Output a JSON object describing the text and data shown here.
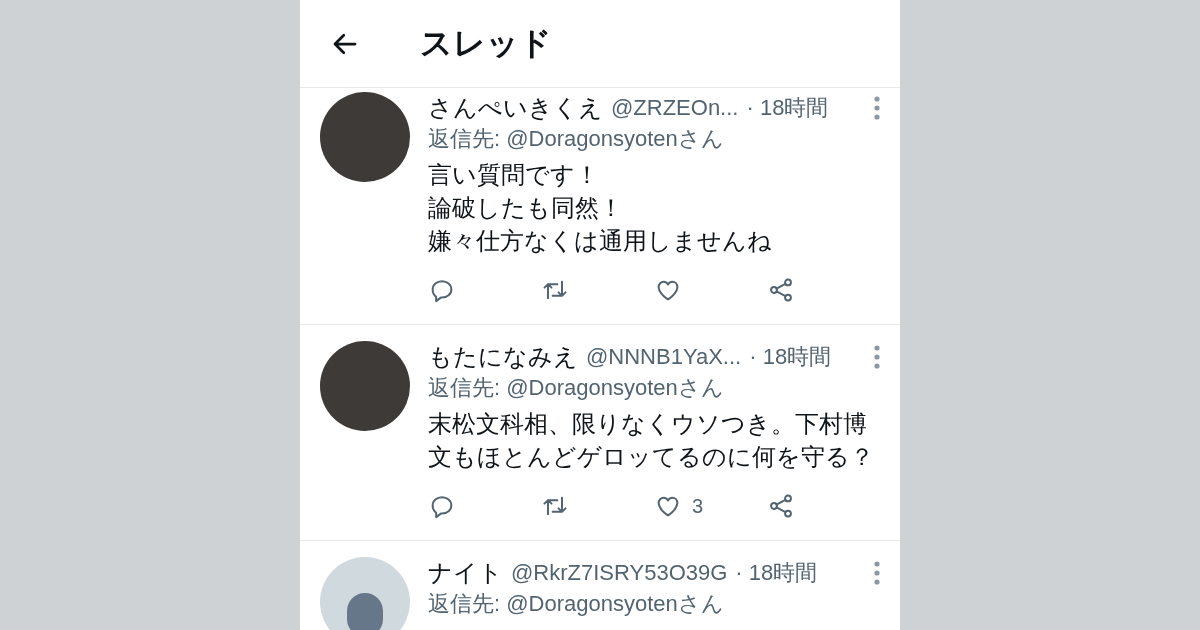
{
  "header": {
    "title": "スレッド"
  },
  "tweets": [
    {
      "name": "さんぺいきくえ",
      "handle": "@ZRZEOn...",
      "time": "· 18時間",
      "reply_to": "返信先: @Doragonsyotenさん",
      "text_lines": [
        "言い質問です！",
        "論破したも同然！",
        "嫌々仕方なくは通用しませんね"
      ],
      "has_photo": true
    },
    {
      "name": "もたになみえ",
      "handle": "@NNNB1YaX...",
      "time": "· 18時間",
      "reply_to": "返信先: @Doragonsyotenさん",
      "text_lines": [
        "末松文科相、限りなくウソつき。下村博文もほとんどゲロッてるのに何を守る？"
      ],
      "has_photo": true,
      "likes": "3"
    },
    {
      "name": "ナイト",
      "handle": "@RkrZ7ISRY53O39G",
      "time": "· 18時間",
      "reply_to": "返信先: @Doragonsyotenさん",
      "has_photo": false
    }
  ]
}
